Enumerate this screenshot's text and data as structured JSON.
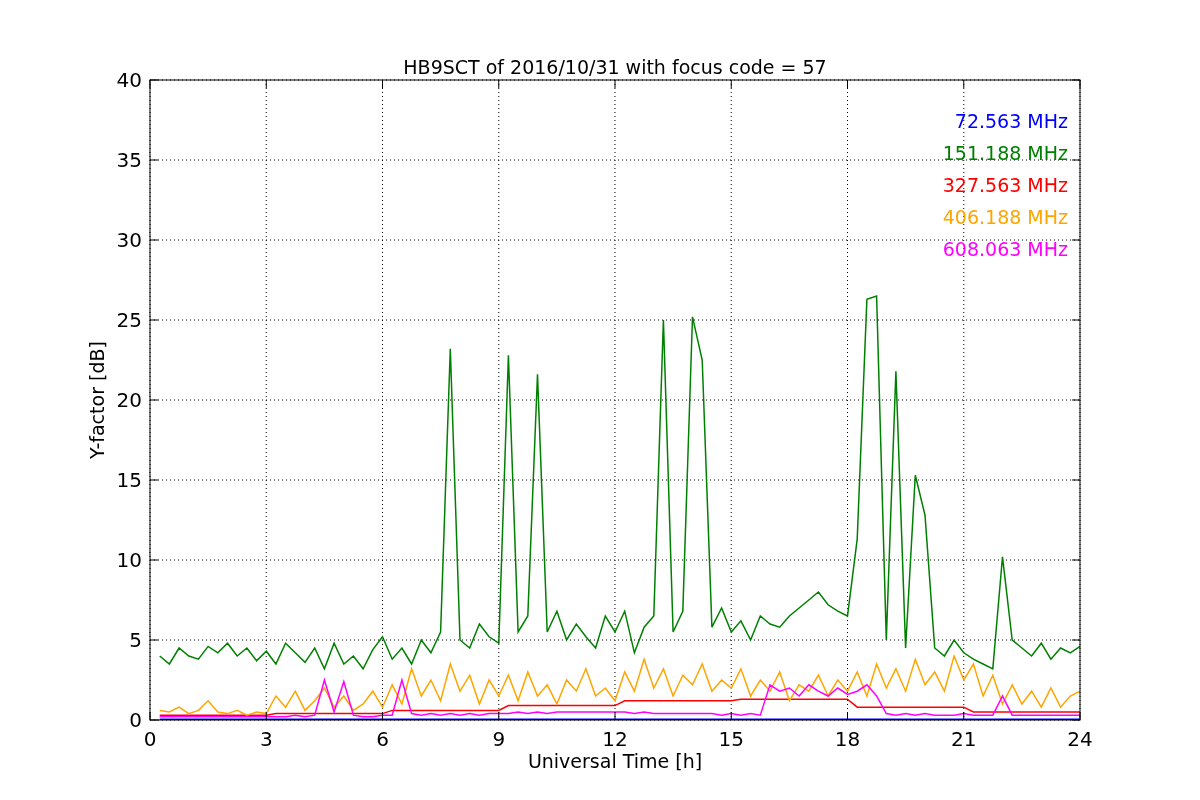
{
  "plot": {
    "chart_data": {
      "type": "line",
      "grid": true,
      "title": "HB9SCT of 2016/10/31 with focus code = 57",
      "xlabel": "Universal Time [h]",
      "ylabel": "Y-factor [dB]",
      "xlim": [
        0,
        24
      ],
      "ylim": [
        0,
        40
      ],
      "xticks": [
        0,
        3,
        6,
        9,
        12,
        15,
        18,
        21,
        24
      ],
      "yticks": [
        0,
        5,
        10,
        15,
        20,
        25,
        30,
        35,
        40
      ],
      "x": [
        0.25,
        0.5,
        0.75,
        1,
        1.25,
        1.5,
        1.75,
        2,
        2.25,
        2.5,
        2.75,
        3,
        3.25,
        3.5,
        3.75,
        4,
        4.25,
        4.5,
        4.75,
        5,
        5.25,
        5.5,
        5.75,
        6,
        6.25,
        6.5,
        6.75,
        7,
        7.25,
        7.5,
        7.75,
        8,
        8.25,
        8.5,
        8.75,
        9,
        9.25,
        9.5,
        9.75,
        10,
        10.25,
        10.5,
        10.75,
        11,
        11.25,
        11.5,
        11.75,
        12,
        12.25,
        12.5,
        12.75,
        13,
        13.25,
        13.5,
        13.75,
        14,
        14.25,
        14.5,
        14.75,
        15,
        15.25,
        15.5,
        15.75,
        16,
        16.25,
        16.5,
        16.75,
        17,
        17.25,
        17.5,
        17.75,
        18,
        18.25,
        18.5,
        18.75,
        19,
        19.25,
        19.5,
        19.75,
        20,
        20.25,
        20.5,
        20.75,
        21,
        21.25,
        21.5,
        21.75,
        22,
        22.25,
        22.5,
        22.75,
        23,
        23.25,
        23.5,
        23.75,
        24
      ],
      "series": [
        {
          "name": "72.563 MHz",
          "color": "#0000ff",
          "values": [
            0.05,
            0.05,
            0.05,
            0.05,
            0.05,
            0.05,
            0.05,
            0.05,
            0.05,
            0.05,
            0.05,
            0.05,
            0.05,
            0.05,
            0.05,
            0.05,
            0.05,
            0.05,
            0.05,
            0.05,
            0.05,
            0.05,
            0.05,
            0.05,
            0.05,
            0.05,
            0.05,
            0.05,
            0.05,
            0.05,
            0.05,
            0.05,
            0.05,
            0.05,
            0.05,
            0.05,
            0.05,
            0.05,
            0.05,
            0.05,
            0.05,
            0.05,
            0.05,
            0.05,
            0.05,
            0.05,
            0.05,
            0.05,
            0.05,
            0.05,
            0.05,
            0.05,
            0.05,
            0.05,
            0.05,
            0.05,
            0.05,
            0.05,
            0.05,
            0.05,
            0.05,
            0.05,
            0.05,
            0.05,
            0.05,
            0.05,
            0.05,
            0.05,
            0.05,
            0.05,
            0.05,
            0.05,
            0.05,
            0.05,
            0.05,
            0.05,
            0.05,
            0.05,
            0.05,
            0.05,
            0.05,
            0.05,
            0.05,
            0.05,
            0.05,
            0.05,
            0.05,
            0.05,
            0.05,
            0.05,
            0.05,
            0.05,
            0.05,
            0.05,
            0.05,
            0.05
          ]
        },
        {
          "name": "151.188 MHz",
          "color": "#008000",
          "values": [
            4,
            3.5,
            4.5,
            4,
            3.8,
            4.6,
            4.2,
            4.8,
            4,
            4.5,
            3.7,
            4.3,
            3.5,
            4.8,
            4.2,
            3.6,
            4.5,
            3.2,
            4.8,
            3.5,
            4,
            3.2,
            4.4,
            5.2,
            3.8,
            4.5,
            3.5,
            5,
            4.2,
            5.5,
            23.2,
            5,
            4.5,
            6,
            5.2,
            4.8,
            22.8,
            5.5,
            6.5,
            21.6,
            5.5,
            6.8,
            5,
            6,
            5.2,
            4.5,
            6.5,
            5.5,
            6.8,
            4.2,
            5.8,
            6.5,
            25,
            5.5,
            6.8,
            25.2,
            22.5,
            5.8,
            7,
            5.5,
            6.2,
            5,
            6.5,
            6,
            5.8,
            6.5,
            7,
            7.5,
            8,
            7.2,
            6.8,
            6.5,
            11.3,
            26.3,
            26.5,
            5,
            21.8,
            4.5,
            15.3,
            12.8,
            4.5,
            4,
            5,
            4.2,
            3.8,
            3.5,
            3.2,
            10.2,
            5,
            4.5,
            4,
            4.8,
            3.8,
            4.5,
            4.2,
            4.6
          ]
        },
        {
          "name": "327.563 MHz",
          "color": "#ff0000",
          "values": [
            0.3,
            0.3,
            0.3,
            0.3,
            0.3,
            0.3,
            0.3,
            0.3,
            0.3,
            0.3,
            0.3,
            0.3,
            0.4,
            0.4,
            0.4,
            0.4,
            0.4,
            0.4,
            0.4,
            0.4,
            0.4,
            0.4,
            0.4,
            0.4,
            0.6,
            0.6,
            0.6,
            0.6,
            0.6,
            0.6,
            0.6,
            0.6,
            0.6,
            0.6,
            0.6,
            0.6,
            0.9,
            0.9,
            0.9,
            0.9,
            0.9,
            0.9,
            0.9,
            0.9,
            0.9,
            0.9,
            0.9,
            0.9,
            1.2,
            1.2,
            1.2,
            1.2,
            1.2,
            1.2,
            1.2,
            1.2,
            1.2,
            1.2,
            1.2,
            1.2,
            1.3,
            1.3,
            1.3,
            1.3,
            1.3,
            1.3,
            1.3,
            1.3,
            1.3,
            1.3,
            1.3,
            1.3,
            0.8,
            0.8,
            0.8,
            0.8,
            0.8,
            0.8,
            0.8,
            0.8,
            0.8,
            0.8,
            0.8,
            0.8,
            0.5,
            0.5,
            0.5,
            0.5,
            0.5,
            0.5,
            0.5,
            0.5,
            0.5,
            0.5,
            0.5,
            0.5
          ]
        },
        {
          "name": "406.188 MHz",
          "color": "#ffa500",
          "values": [
            0.6,
            0.5,
            0.8,
            0.4,
            0.6,
            1.2,
            0.5,
            0.4,
            0.6,
            0.3,
            0.5,
            0.4,
            1.5,
            0.8,
            1.8,
            0.6,
            1.2,
            2.0,
            0.8,
            1.5,
            0.6,
            1.0,
            1.8,
            0.8,
            2.2,
            1.0,
            3.2,
            1.5,
            2.5,
            1.2,
            3.5,
            1.8,
            2.8,
            1.0,
            2.5,
            1.5,
            2.8,
            1.2,
            3.0,
            1.5,
            2.2,
            1.0,
            2.5,
            1.8,
            3.2,
            1.5,
            2.0,
            1.2,
            3.0,
            1.8,
            3.8,
            2.0,
            3.2,
            1.5,
            2.8,
            2.2,
            3.5,
            1.8,
            2.5,
            2.0,
            3.2,
            1.5,
            2.5,
            1.8,
            3.0,
            1.2,
            2.2,
            1.8,
            2.8,
            1.5,
            2.5,
            1.8,
            3.0,
            1.5,
            3.5,
            2.0,
            3.2,
            1.8,
            3.8,
            2.2,
            3.0,
            1.8,
            4.0,
            2.5,
            3.5,
            1.5,
            2.8,
            1.0,
            2.2,
            1.0,
            1.8,
            0.8,
            2.0,
            0.8,
            1.5,
            1.8
          ]
        },
        {
          "name": "608.063 MHz",
          "color": "#ff00ff",
          "values": [
            0.2,
            0.2,
            0.2,
            0.2,
            0.2,
            0.2,
            0.2,
            0.2,
            0.2,
            0.2,
            0.2,
            0.2,
            0.2,
            0.2,
            0.3,
            0.2,
            0.3,
            2.5,
            0.5,
            2.4,
            0.3,
            0.2,
            0.2,
            0.3,
            0.3,
            2.5,
            0.4,
            0.3,
            0.4,
            0.3,
            0.4,
            0.3,
            0.4,
            0.3,
            0.4,
            0.4,
            0.4,
            0.5,
            0.4,
            0.5,
            0.4,
            0.5,
            0.5,
            0.5,
            0.5,
            0.5,
            0.5,
            0.5,
            0.5,
            0.4,
            0.5,
            0.4,
            0.4,
            0.4,
            0.4,
            0.4,
            0.4,
            0.4,
            0.3,
            0.4,
            0.3,
            0.4,
            0.3,
            2.2,
            1.8,
            2.0,
            1.5,
            2.2,
            1.8,
            1.5,
            2.0,
            1.6,
            1.8,
            2.2,
            1.5,
            0.4,
            0.3,
            0.4,
            0.3,
            0.4,
            0.3,
            0.3,
            0.3,
            0.4,
            0.3,
            0.3,
            0.3,
            1.5,
            0.3,
            0.3,
            0.3,
            0.3,
            0.3,
            0.3,
            0.3,
            0.3
          ]
        }
      ]
    }
  }
}
